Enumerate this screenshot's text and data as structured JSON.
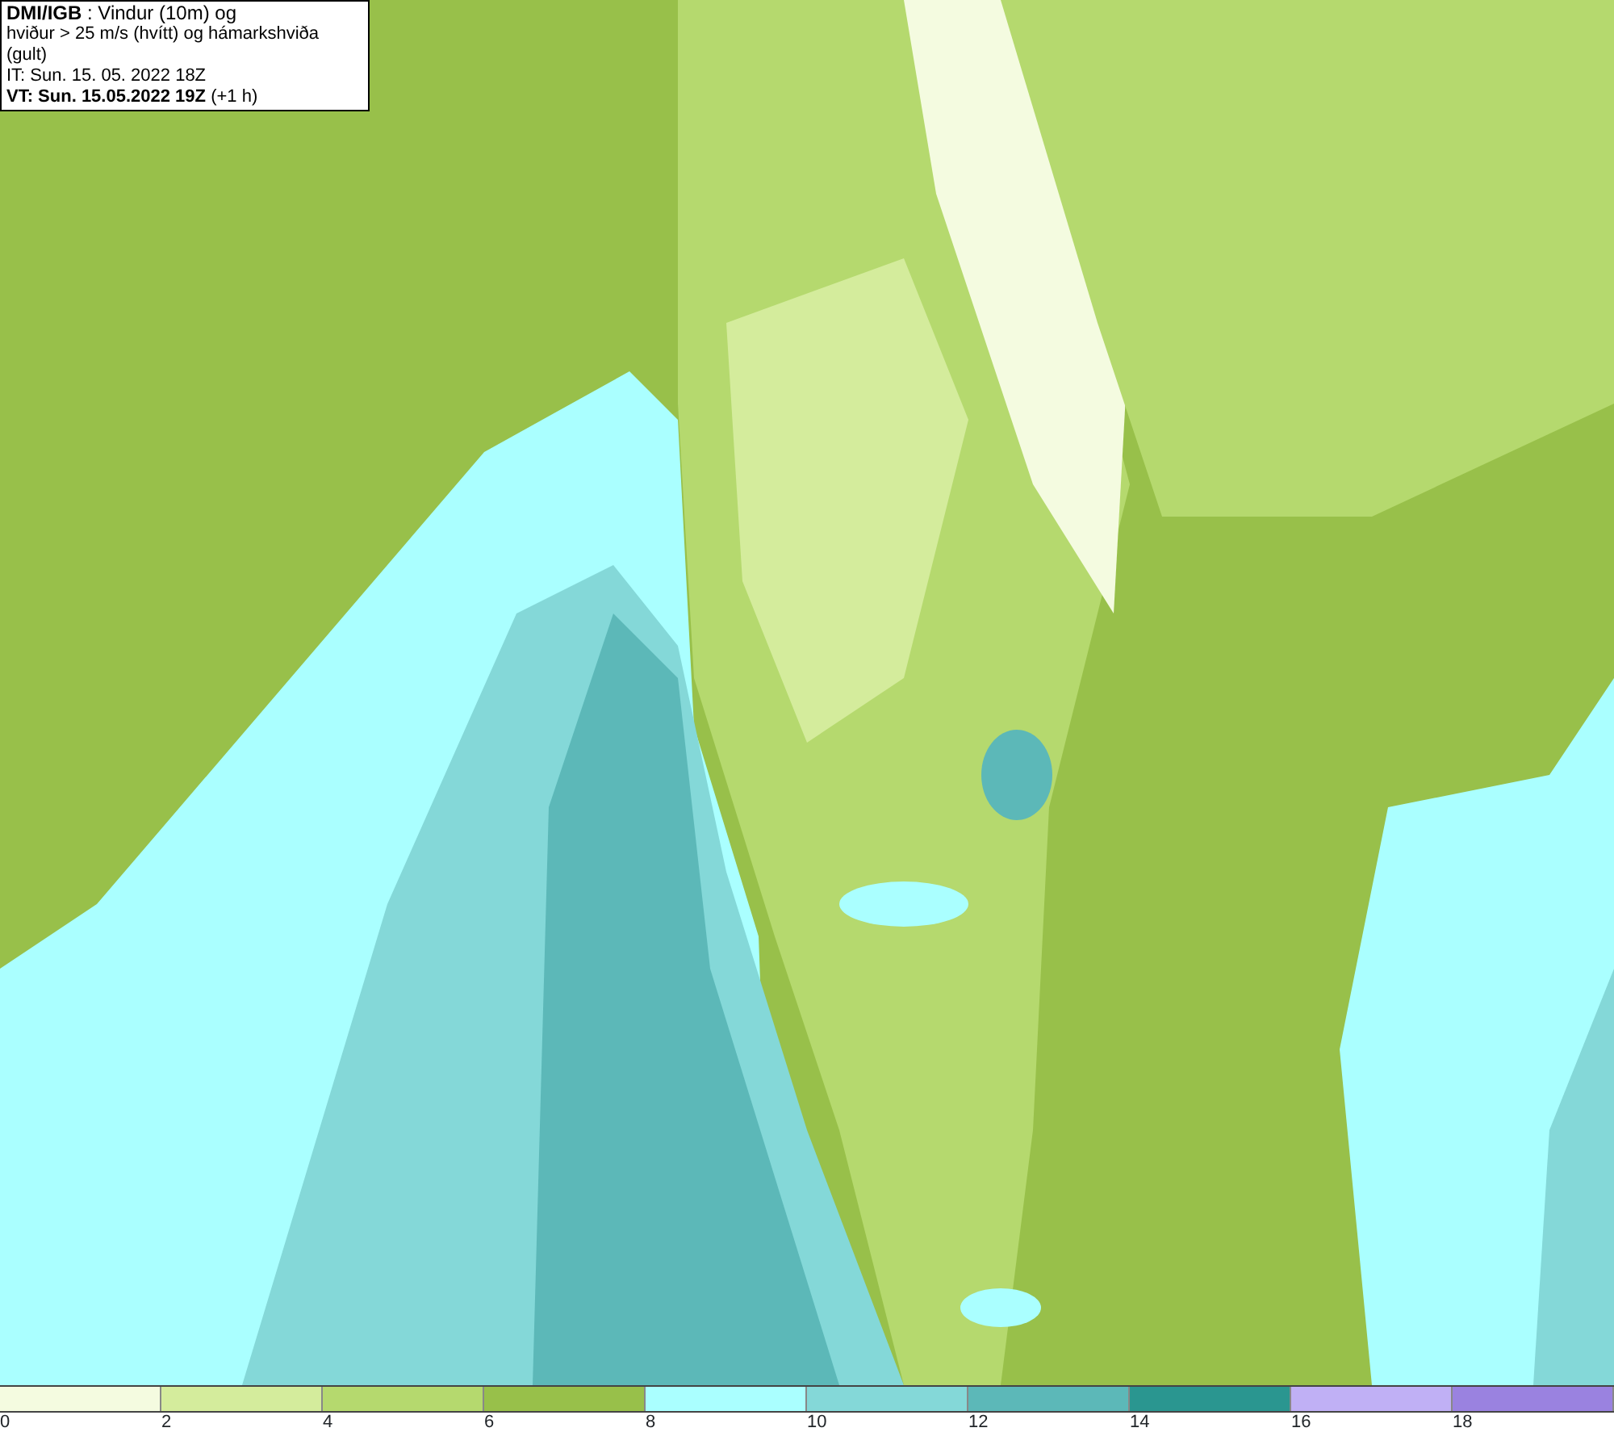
{
  "title_box": {
    "lines": [
      "**DMI/IGB** : Vindur (10m) og",
      "hviður > 25 m/s (hvítt) og hámarkshviða (gult)",
      "IT: Sun. 15. 05. 2022 18Z",
      "**VT: Sun. 15.05.2022 19Z** (+1 h)"
    ]
  },
  "legend": {
    "bins": [
      {
        "color": "#f4fbe0",
        "label": "0"
      },
      {
        "color": "#d4ec9c",
        "label": "2"
      },
      {
        "color": "#b5d96e",
        "label": "4"
      },
      {
        "color": "#98c04a",
        "label": "6"
      },
      {
        "color": "#aaffff",
        "label": "8"
      },
      {
        "color": "#84d8d8",
        "label": "10"
      },
      {
        "color": "#5cb8b8",
        "label": "12"
      },
      {
        "color": "#2a9690",
        "label": "14"
      },
      {
        "color": "#c0b0f5",
        "label": "16"
      },
      {
        "color": "#9a82e0",
        "label": "18"
      }
    ]
  }
}
